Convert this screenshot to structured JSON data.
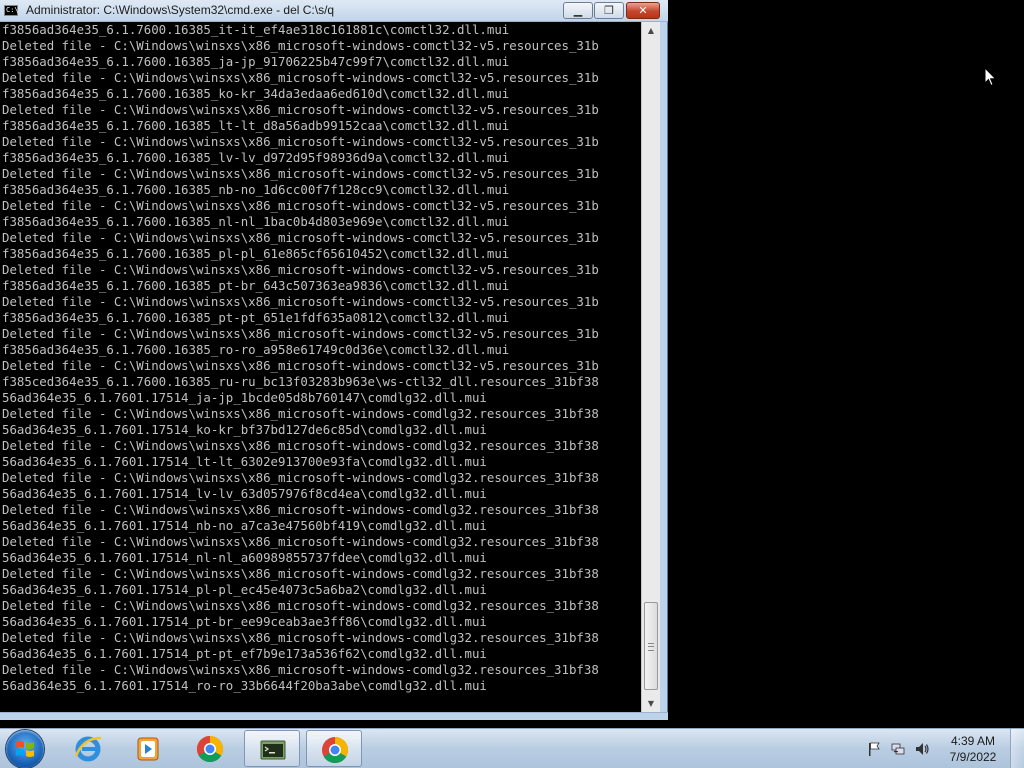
{
  "window": {
    "title": "Administrator: C:\\Windows\\System32\\cmd.exe - del  C:\\s/q",
    "minimize_label": "▁",
    "maximize_label": "❐",
    "close_label": "✕",
    "icon_text": "C:\\"
  },
  "console": {
    "lines": [
      "f3856ad364e35_6.1.7600.16385_it-it_ef4ae318c161881c\\comctl32.dll.mui",
      "Deleted file - C:\\Windows\\winsxs\\x86_microsoft-windows-comctl32-v5.resources_31b",
      "f3856ad364e35_6.1.7600.16385_ja-jp_91706225b47c99f7\\comctl32.dll.mui",
      "Deleted file - C:\\Windows\\winsxs\\x86_microsoft-windows-comctl32-v5.resources_31b",
      "f3856ad364e35_6.1.7600.16385_ko-kr_34da3edaa6ed610d\\comctl32.dll.mui",
      "Deleted file - C:\\Windows\\winsxs\\x86_microsoft-windows-comctl32-v5.resources_31b",
      "f3856ad364e35_6.1.7600.16385_lt-lt_d8a56adb99152caa\\comctl32.dll.mui",
      "Deleted file - C:\\Windows\\winsxs\\x86_microsoft-windows-comctl32-v5.resources_31b",
      "f3856ad364e35_6.1.7600.16385_lv-lv_d972d95f98936d9a\\comctl32.dll.mui",
      "Deleted file - C:\\Windows\\winsxs\\x86_microsoft-windows-comctl32-v5.resources_31b",
      "f3856ad364e35_6.1.7600.16385_nb-no_1d6cc00f7f128cc9\\comctl32.dll.mui",
      "Deleted file - C:\\Windows\\winsxs\\x86_microsoft-windows-comctl32-v5.resources_31b",
      "f3856ad364e35_6.1.7600.16385_nl-nl_1bac0b4d803e969e\\comctl32.dll.mui",
      "Deleted file - C:\\Windows\\winsxs\\x86_microsoft-windows-comctl32-v5.resources_31b",
      "f3856ad364e35_6.1.7600.16385_pl-pl_61e865cf65610452\\comctl32.dll.mui",
      "Deleted file - C:\\Windows\\winsxs\\x86_microsoft-windows-comctl32-v5.resources_31b",
      "f3856ad364e35_6.1.7600.16385_pt-br_643c507363ea9836\\comctl32.dll.mui",
      "Deleted file - C:\\Windows\\winsxs\\x86_microsoft-windows-comctl32-v5.resources_31b",
      "f3856ad364e35_6.1.7600.16385_pt-pt_651e1fdf635a0812\\comctl32.dll.mui",
      "Deleted file - C:\\Windows\\winsxs\\x86_microsoft-windows-comctl32-v5.resources_31b",
      "f3856ad364e35_6.1.7600.16385_ro-ro_a958e61749c0d36e\\comctl32.dll.mui",
      "Deleted file - C:\\Windows\\winsxs\\x86_microsoft-windows-comctl32-v5.resources_31b",
      "f385ced364e35_6.1.7600.16385_ru-ru_bc13f03283b963e\\ws-ctl32_dll.resources_31bf38",
      "56ad364e35_6.1.7601.17514_ja-jp_1bcde05d8b760147\\comdlg32.dll.mui",
      "Deleted file - C:\\Windows\\winsxs\\x86_microsoft-windows-comdlg32.resources_31bf38",
      "56ad364e35_6.1.7601.17514_ko-kr_bf37bd127de6c85d\\comdlg32.dll.mui",
      "Deleted file - C:\\Windows\\winsxs\\x86_microsoft-windows-comdlg32.resources_31bf38",
      "56ad364e35_6.1.7601.17514_lt-lt_6302e913700e93fa\\comdlg32.dll.mui",
      "Deleted file - C:\\Windows\\winsxs\\x86_microsoft-windows-comdlg32.resources_31bf38",
      "56ad364e35_6.1.7601.17514_lv-lv_63d057976f8cd4ea\\comdlg32.dll.mui",
      "Deleted file - C:\\Windows\\winsxs\\x86_microsoft-windows-comdlg32.resources_31bf38",
      "56ad364e35_6.1.7601.17514_nb-no_a7ca3e47560bf419\\comdlg32.dll.mui",
      "Deleted file - C:\\Windows\\winsxs\\x86_microsoft-windows-comdlg32.resources_31bf38",
      "56ad364e35_6.1.7601.17514_nl-nl_a60989855737fdee\\comdlg32.dll.mui",
      "Deleted file - C:\\Windows\\winsxs\\x86_microsoft-windows-comdlg32.resources_31bf38",
      "56ad364e35_6.1.7601.17514_pl-pl_ec45e4073c5a6ba2\\comdlg32.dll.mui",
      "Deleted file - C:\\Windows\\winsxs\\x86_microsoft-windows-comdlg32.resources_31bf38",
      "56ad364e35_6.1.7601.17514_pt-br_ee99ceab3ae3ff86\\comdlg32.dll.mui",
      "Deleted file - C:\\Windows\\winsxs\\x86_microsoft-windows-comdlg32.resources_31bf38",
      "56ad364e35_6.1.7601.17514_pt-pt_ef7b9e173a536f62\\comdlg32.dll.mui",
      "Deleted file - C:\\Windows\\winsxs\\x86_microsoft-windows-comdlg32.resources_31bf38",
      "56ad364e35_6.1.7601.17514_ro-ro_33b6644f20ba3abe\\comdlg32.dll.mui"
    ]
  },
  "taskbar": {
    "items": [
      {
        "name": "internet-explorer",
        "icon": "ie-icon"
      },
      {
        "name": "media-player",
        "icon": "media-player-icon"
      },
      {
        "name": "chrome",
        "icon": "chrome-icon"
      },
      {
        "name": "cmd",
        "icon": "cmd-icon"
      },
      {
        "name": "chrome-active",
        "icon": "chrome-icon"
      }
    ],
    "clock": {
      "time": "4:39 AM",
      "date": "7/9/2022"
    }
  },
  "colors": {
    "console_bg": "#000000",
    "console_text": "#c0c0c0",
    "window_frame": "#bcd3ea",
    "close_button": "#c5452c"
  }
}
